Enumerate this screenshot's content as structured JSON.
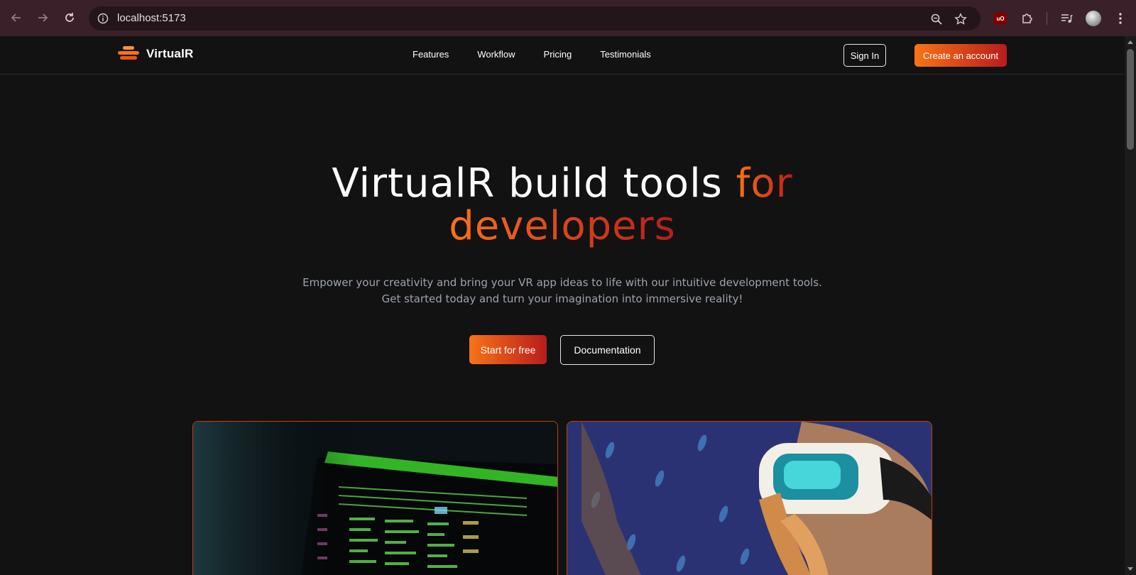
{
  "browser": {
    "url": "localhost:5173",
    "ext_ublock_label": "uO"
  },
  "site": {
    "brand": "VirtualR",
    "nav_links": [
      "Features",
      "Workflow",
      "Pricing",
      "Testimonials"
    ],
    "signin_label": "Sign In",
    "create_account_label": "Create an account"
  },
  "hero": {
    "title_white": "VirtualR build tools ",
    "title_accent_1": "for",
    "title_accent_2": "developers",
    "subtitle_line1": "Empower your creativity and bring your VR app ideas to life with our intuitive development tools.",
    "subtitle_line2": "Get started today and turn your imagination into immersive reality!",
    "cta_primary": "Start for free",
    "cta_secondary": "Documentation"
  },
  "colors": {
    "accent_start": "#f97316",
    "accent_end": "#b91c1c",
    "background": "#121212",
    "card_border": "#c2410c"
  },
  "icons": {
    "back": "back-arrow-icon",
    "forward": "forward-arrow-icon",
    "reload": "reload-icon",
    "site_info": "site-info-icon",
    "zoom": "zoom-icon",
    "bookmark": "star-icon",
    "extensions": "puzzle-icon",
    "media": "media-queue-icon",
    "menu": "kebab-menu-icon"
  }
}
